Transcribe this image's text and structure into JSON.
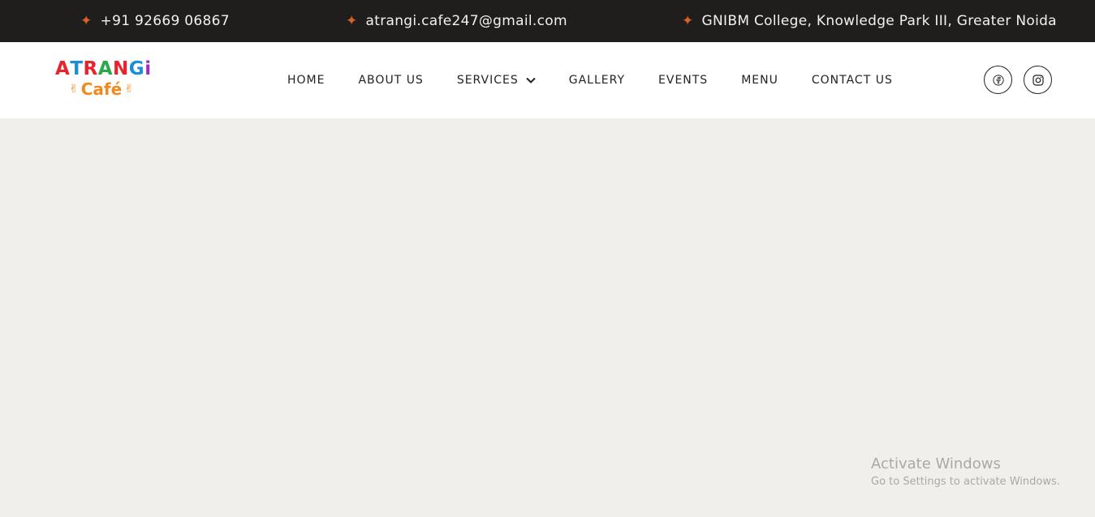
{
  "topbar": {
    "phone": "+91 92669 06867",
    "email": "atrangi.cafe247@gmail.com",
    "address": "GNIBM College, Knowledge Park III, Greater Noida",
    "icon": "star-bullet-icon",
    "bullet": "✦",
    "accent_color": "#d9622b"
  },
  "logo": {
    "top_letters": [
      {
        "char": "A",
        "color": "#e8232b"
      },
      {
        "char": "T",
        "color": "#1b8fd6"
      },
      {
        "char": "R",
        "color": "#e8232b"
      },
      {
        "char": "A",
        "color": "#2aa84a"
      },
      {
        "char": "N",
        "color": "#e8232b"
      },
      {
        "char": "G",
        "color": "#1b8fd6"
      },
      {
        "char": "i",
        "color": "#9b2fbf"
      }
    ],
    "bottom_text": "Café",
    "bottom_color": "#f08a1f"
  },
  "nav": {
    "items": [
      "HOME",
      "ABOUT US",
      "SERVICES",
      "GALLERY",
      "EVENTS",
      "MENU",
      "CONTACT US"
    ]
  },
  "social": {
    "icons": [
      "facebook-icon",
      "instagram-icon"
    ]
  },
  "watermark": {
    "title": "Activate Windows",
    "subtitle": "Go to Settings to activate Windows."
  },
  "colors": {
    "topbar_bg": "#1f1e1d",
    "page_bg": "#f0efeb",
    "header_bg": "#ffffff"
  }
}
